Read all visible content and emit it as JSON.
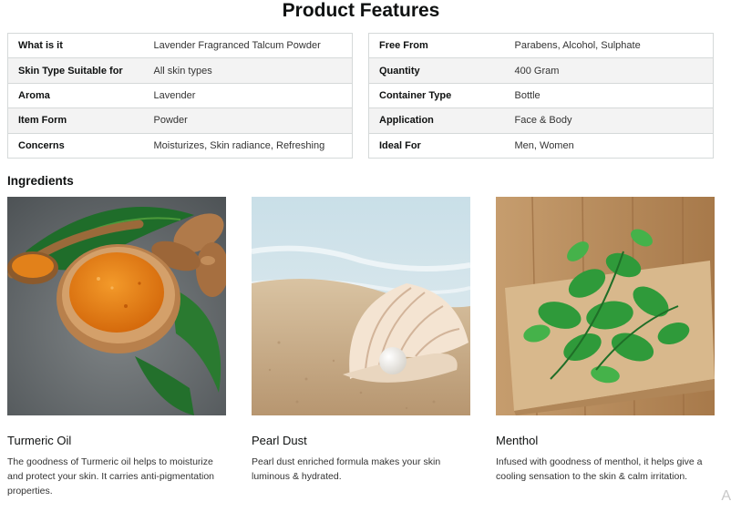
{
  "title": "Product Features",
  "features_left": [
    {
      "key": "What is it",
      "value": "Lavender Fragranced Talcum Powder"
    },
    {
      "key": "Skin Type Suitable for",
      "value": "All skin types"
    },
    {
      "key": "Aroma",
      "value": "Lavender"
    },
    {
      "key": "Item Form",
      "value": "Powder"
    },
    {
      "key": "Concerns",
      "value": "Moisturizes, Skin radiance, Refreshing"
    }
  ],
  "features_right": [
    {
      "key": "Free From",
      "value": "Parabens, Alcohol, Sulphate"
    },
    {
      "key": "Quantity",
      "value": "400 Gram"
    },
    {
      "key": "Container Type",
      "value": "Bottle"
    },
    {
      "key": "Application",
      "value": "Face & Body"
    },
    {
      "key": "Ideal For",
      "value": "Men, Women"
    }
  ],
  "ingredients_heading": "Ingredients",
  "ingredients": [
    {
      "name": "Turmeric Oil",
      "description": "The goodness of Turmeric oil helps to moisturize and protect your skin. It carries anti-pigmentation properties.",
      "image": "turmeric-image"
    },
    {
      "name": "Pearl Dust",
      "description": "Pearl dust enriched formula makes your skin luminous & hydrated.",
      "image": "pearl-shell-image"
    },
    {
      "name": "Menthol",
      "description": "Infused with goodness of menthol, it helps give a cooling sensation to the skin & calm irritation.",
      "image": "mint-leaves-image"
    }
  ],
  "corner_mark": "A"
}
